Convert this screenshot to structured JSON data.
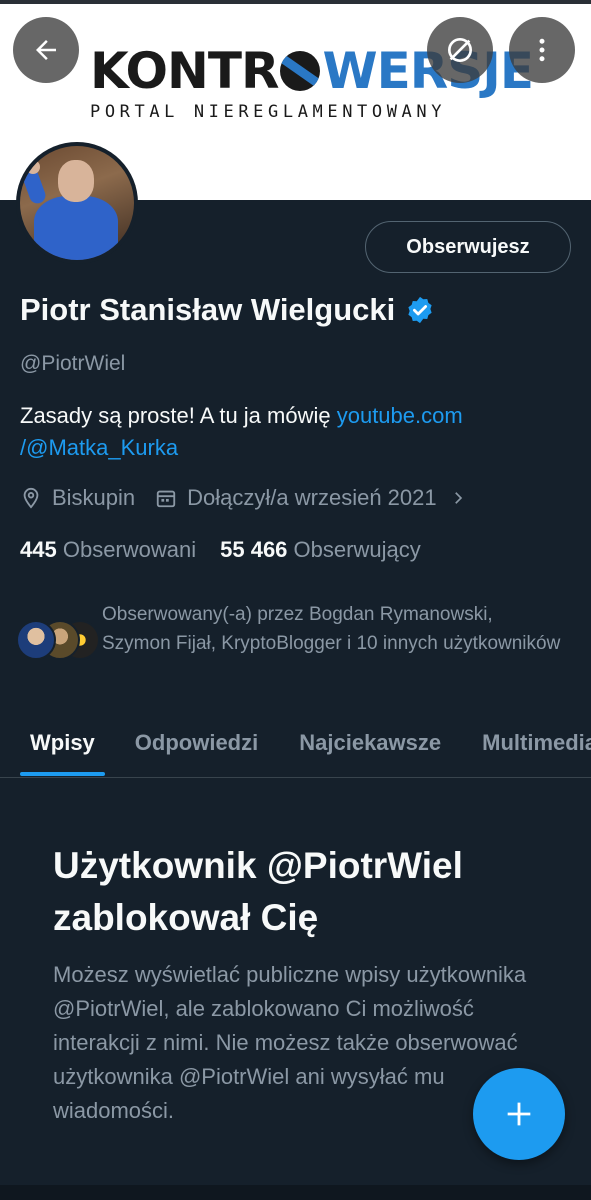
{
  "banner": {
    "logo_text_before": "KONTR",
    "logo_text_after": "WERSJE",
    "logo_tagline": "PORTAL NIEREGLAMENTOWANY"
  },
  "toolbar": {
    "back_icon": "arrow-left-icon",
    "link_icon": "no-link-icon",
    "more_icon": "more-vertical-icon"
  },
  "profile": {
    "follow_state_label": "Obserwujesz",
    "display_name": "Piotr Stanisław Wielgucki",
    "handle": "@PiotrWiel",
    "bio_text": "Zasady są proste! A tu ja mówię ",
    "bio_link_line1": "youtube.com",
    "bio_link_line2": "/@Matka_Kurka",
    "location": "Biskupin",
    "joined": "Dołączył/a wrzesień 2021",
    "following_count": "445",
    "following_label": "Obserwowani",
    "followers_count": "55 466",
    "followers_label": "Obserwujący",
    "followed_by_text": "Obserwowany(-a) przez Bogdan Rymanowski, Szymon Fijał, KryptoBlogger i 10 innych użytkowników"
  },
  "tabs": [
    {
      "label": "Wpisy",
      "active": true
    },
    {
      "label": "Odpowiedzi",
      "active": false
    },
    {
      "label": "Najciekawsze",
      "active": false
    },
    {
      "label": "Multimedia",
      "active": false
    }
  ],
  "blocked": {
    "title": "Użytkownik @PiotrWiel zablokował Cię",
    "description": "Możesz wyświetlać publiczne wpisy użytkownika @PiotrWiel, ale zablokowano Ci możliwość interakcji z nimi. Nie możesz także obserwować użytkownika @PiotrWiel ani wysyłać mu wiadomości."
  },
  "fab": {
    "icon": "plus-icon"
  },
  "colors": {
    "background": "#15202b",
    "accent": "#1d9bf0",
    "muted_text": "#8b98a5",
    "border": "#38444d"
  }
}
